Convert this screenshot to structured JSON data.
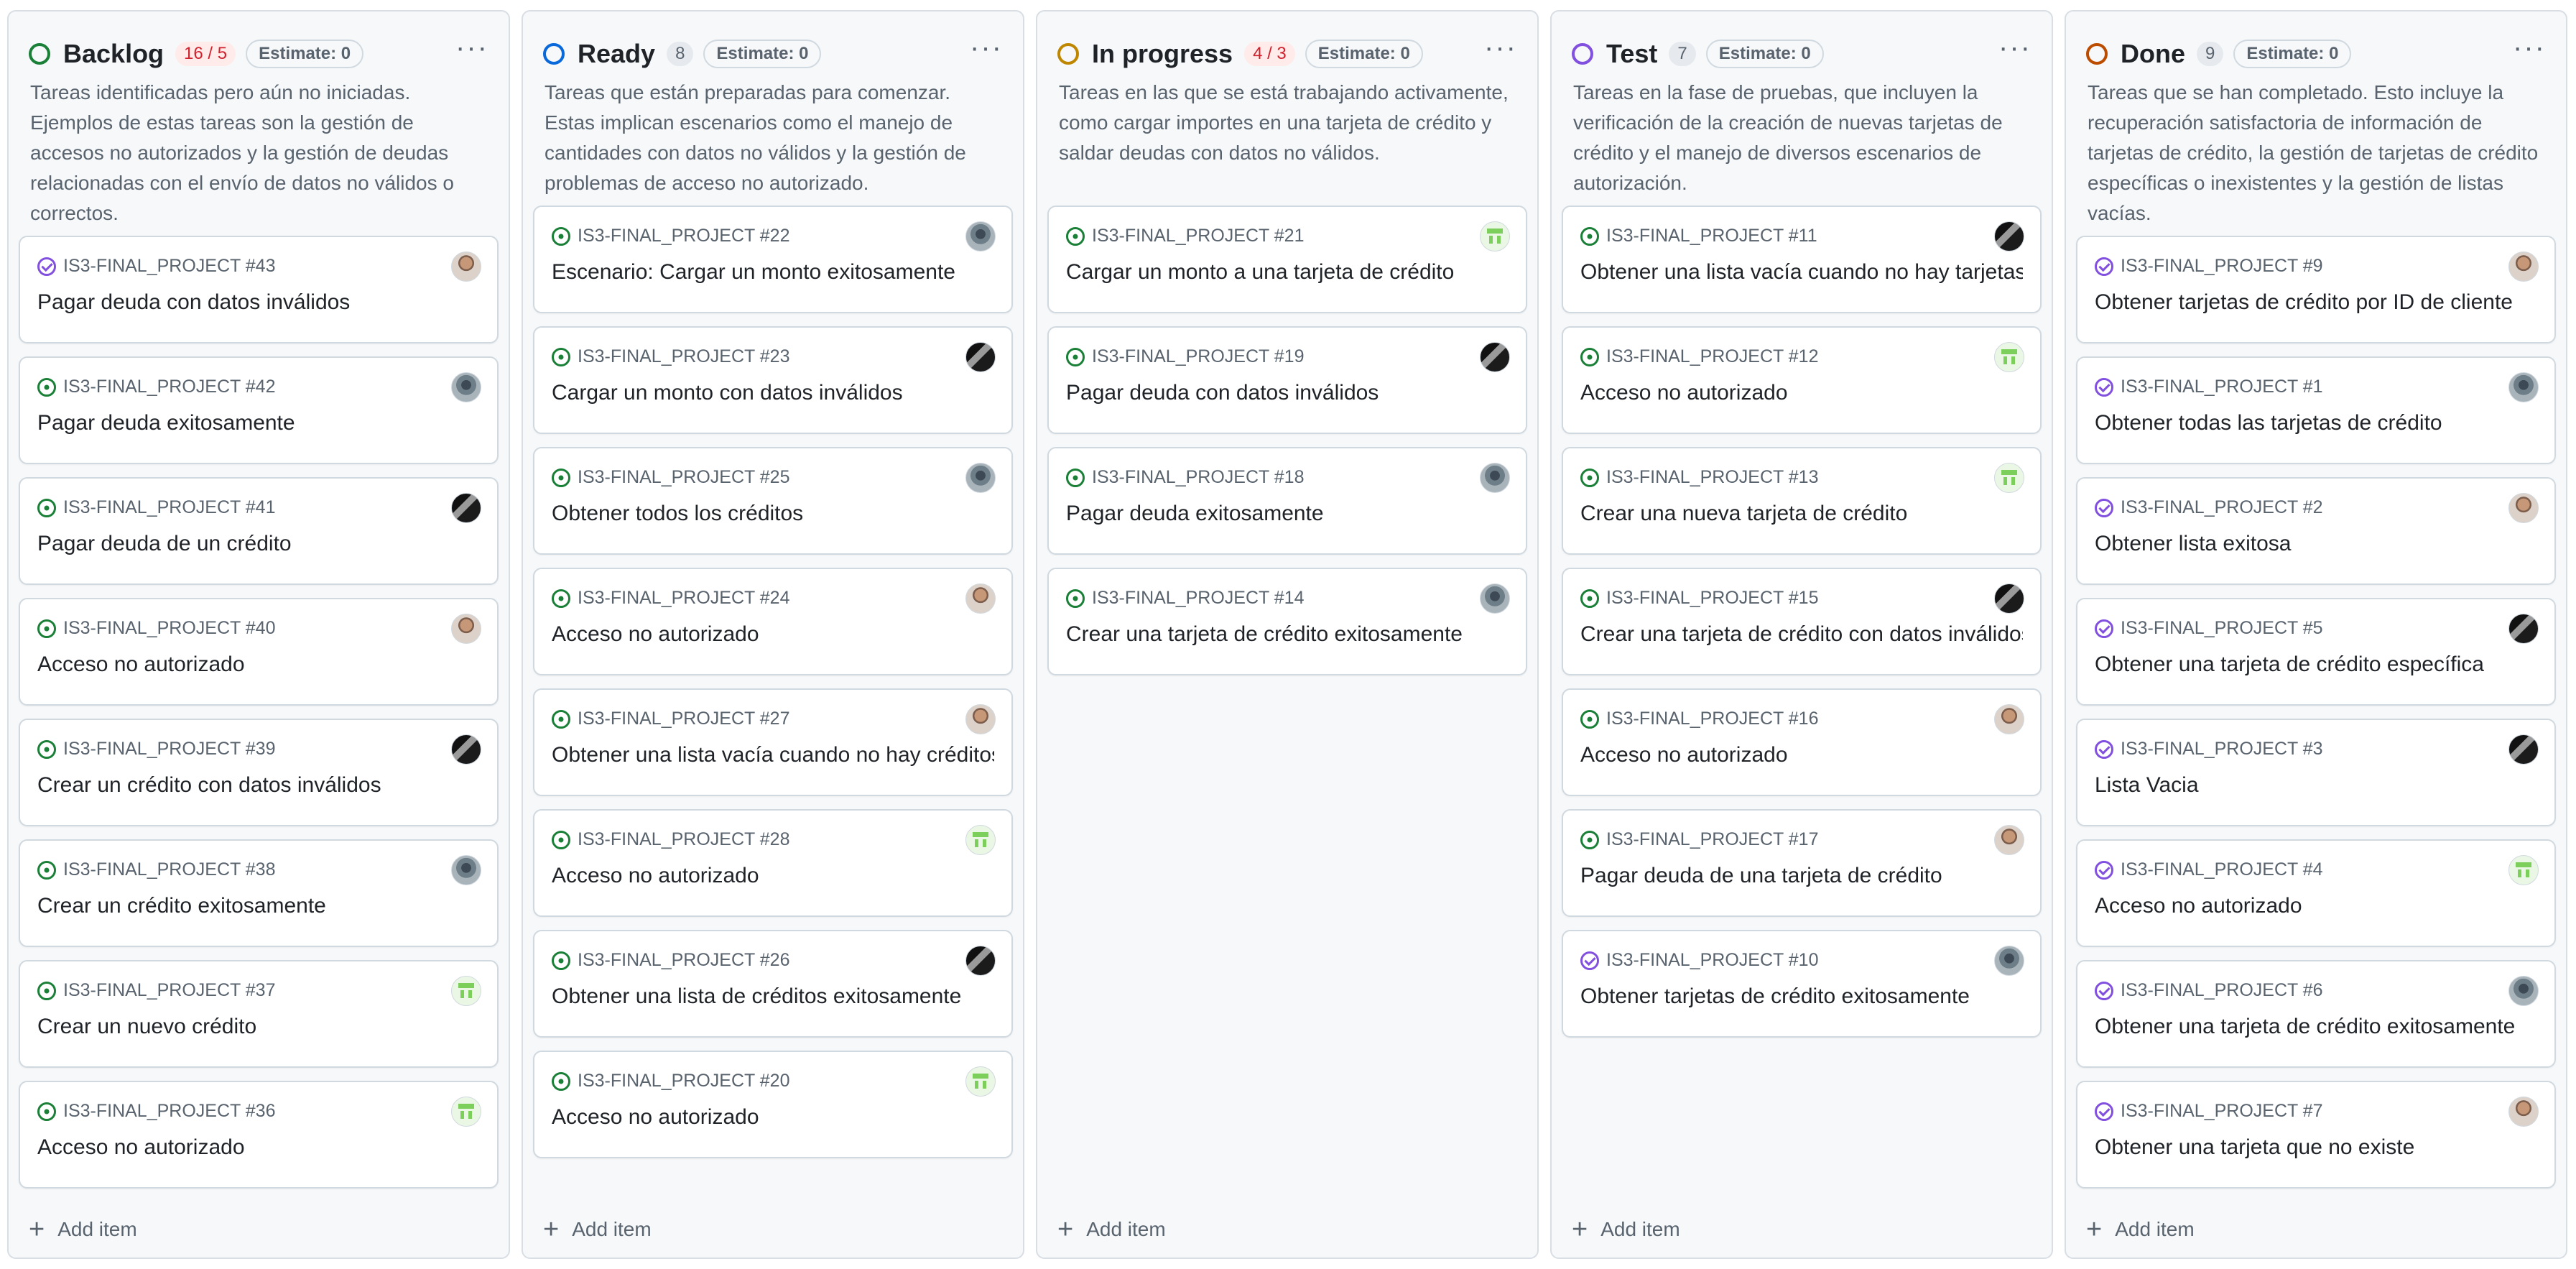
{
  "columns": [
    {
      "title": "Backlog",
      "count": "16 / 5",
      "count_over": true,
      "status_color": "#1a7f37",
      "estimate": "Estimate: 0",
      "description": "Tareas identificadas pero aún no iniciadas. Ejemplos de estas tareas son la gestión de accesos no autorizados y la gestión de deudas relacionadas con el envío de datos no válidos o correctos.",
      "add_item": "Add item",
      "cards": [
        {
          "ref": "IS3-FINAL_PROJECT #43",
          "title": "Pagar deuda con datos inválidos",
          "status": "closed",
          "avatar": "photo"
        },
        {
          "ref": "IS3-FINAL_PROJECT #42",
          "title": "Pagar deuda exitosamente",
          "status": "open",
          "avatar": "cap"
        },
        {
          "ref": "IS3-FINAL_PROJECT #41",
          "title": "Pagar deuda de un crédito",
          "status": "open",
          "avatar": "dark"
        },
        {
          "ref": "IS3-FINAL_PROJECT #40",
          "title": "Acceso no autorizado",
          "status": "open",
          "avatar": "photo"
        },
        {
          "ref": "IS3-FINAL_PROJECT #39",
          "title": "Crear un crédito con datos inválidos",
          "status": "open",
          "avatar": "dark"
        },
        {
          "ref": "IS3-FINAL_PROJECT #38",
          "title": "Crear un crédito exitosamente",
          "status": "open",
          "avatar": "cap"
        },
        {
          "ref": "IS3-FINAL_PROJECT #37",
          "title": "Crear un nuevo crédito",
          "status": "open",
          "avatar": "green"
        },
        {
          "ref": "IS3-FINAL_PROJECT #36",
          "title": "Acceso no autorizado",
          "status": "open",
          "avatar": "green"
        }
      ]
    },
    {
      "title": "Ready",
      "count": "8",
      "count_over": false,
      "status_color": "#0969da",
      "estimate": "Estimate: 0",
      "description": "Tareas que están preparadas para comenzar. Estas implican escenarios como el manejo de cantidades con datos no válidos y la gestión de problemas de acceso no autorizado.",
      "add_item": "Add item",
      "cards": [
        {
          "ref": "IS3-FINAL_PROJECT #22",
          "title": "Escenario: Cargar un monto exitosamente",
          "status": "open",
          "avatar": "cap"
        },
        {
          "ref": "IS3-FINAL_PROJECT #23",
          "title": "Cargar un monto con datos inválidos",
          "status": "open",
          "avatar": "dark"
        },
        {
          "ref": "IS3-FINAL_PROJECT #25",
          "title": "Obtener todos los créditos",
          "status": "open",
          "avatar": "cap"
        },
        {
          "ref": "IS3-FINAL_PROJECT #24",
          "title": "Acceso no autorizado",
          "status": "open",
          "avatar": "photo"
        },
        {
          "ref": "IS3-FINAL_PROJECT #27",
          "title": "Obtener una lista vacía cuando no hay créditos",
          "status": "open",
          "avatar": "photo"
        },
        {
          "ref": "IS3-FINAL_PROJECT #28",
          "title": "Acceso no autorizado",
          "status": "open",
          "avatar": "green"
        },
        {
          "ref": "IS3-FINAL_PROJECT #26",
          "title": "Obtener una lista de créditos exitosamente",
          "status": "open",
          "avatar": "dark"
        },
        {
          "ref": "IS3-FINAL_PROJECT #20",
          "title": "Acceso no autorizado",
          "status": "open",
          "avatar": "green"
        }
      ]
    },
    {
      "title": "In progress",
      "count": "4 / 3",
      "count_over": true,
      "status_color": "#bf8700",
      "estimate": "Estimate: 0",
      "description": "Tareas en las que se está trabajando activamente, como cargar importes en una tarjeta de crédito y saldar deudas con datos no válidos.",
      "add_item": "Add item",
      "cards": [
        {
          "ref": "IS3-FINAL_PROJECT #21",
          "title": "Cargar un monto a una tarjeta de crédito",
          "status": "open",
          "avatar": "green"
        },
        {
          "ref": "IS3-FINAL_PROJECT #19",
          "title": "Pagar deuda con datos inválidos",
          "status": "open",
          "avatar": "dark"
        },
        {
          "ref": "IS3-FINAL_PROJECT #18",
          "title": "Pagar deuda exitosamente",
          "status": "open",
          "avatar": "cap"
        },
        {
          "ref": "IS3-FINAL_PROJECT #14",
          "title": "Crear una tarjeta de crédito exitosamente",
          "status": "open",
          "avatar": "cap"
        }
      ]
    },
    {
      "title": "Test",
      "count": "7",
      "count_over": false,
      "status_color": "#8250df",
      "estimate": "Estimate: 0",
      "description": "Tareas en la fase de pruebas, que incluyen la verificación de la creación de nuevas tarjetas de crédito y el manejo de diversos escenarios de autorización.",
      "add_item": "Add item",
      "cards": [
        {
          "ref": "IS3-FINAL_PROJECT #11",
          "title": "Obtener una lista vacía cuando no hay tarjetas",
          "status": "open",
          "avatar": "dark"
        },
        {
          "ref": "IS3-FINAL_PROJECT #12",
          "title": "Acceso no autorizado",
          "status": "open",
          "avatar": "green"
        },
        {
          "ref": "IS3-FINAL_PROJECT #13",
          "title": "Crear una nueva tarjeta de crédito",
          "status": "open",
          "avatar": "green"
        },
        {
          "ref": "IS3-FINAL_PROJECT #15",
          "title": "Crear una tarjeta de crédito con datos inválidos",
          "status": "open",
          "avatar": "dark"
        },
        {
          "ref": "IS3-FINAL_PROJECT #16",
          "title": "Acceso no autorizado",
          "status": "open",
          "avatar": "photo"
        },
        {
          "ref": "IS3-FINAL_PROJECT #17",
          "title": "Pagar deuda de una tarjeta de crédito",
          "status": "open",
          "avatar": "photo"
        },
        {
          "ref": "IS3-FINAL_PROJECT #10",
          "title": "Obtener tarjetas de crédito exitosamente",
          "status": "closed",
          "avatar": "cap"
        }
      ]
    },
    {
      "title": "Done",
      "count": "9",
      "count_over": false,
      "status_color": "#bc4c00",
      "estimate": "Estimate: 0",
      "description": "Tareas que se han completado. Esto incluye la recuperación satisfactoria de información de tarjetas de crédito, la gestión de tarjetas de crédito específicas o inexistentes y la gestión de listas vacías.",
      "add_item": "Add item",
      "cards": [
        {
          "ref": "IS3-FINAL_PROJECT #9",
          "title": "Obtener tarjetas de crédito por ID de cliente",
          "status": "closed",
          "avatar": "photo"
        },
        {
          "ref": "IS3-FINAL_PROJECT #1",
          "title": "Obtener todas las tarjetas de crédito",
          "status": "closed",
          "avatar": "cap"
        },
        {
          "ref": "IS3-FINAL_PROJECT #2",
          "title": "Obtener lista exitosa",
          "status": "closed",
          "avatar": "photo"
        },
        {
          "ref": "IS3-FINAL_PROJECT #5",
          "title": "Obtener una tarjeta de crédito específica",
          "status": "closed",
          "avatar": "dark"
        },
        {
          "ref": "IS3-FINAL_PROJECT #3",
          "title": "Lista Vacia",
          "status": "closed",
          "avatar": "dark"
        },
        {
          "ref": "IS3-FINAL_PROJECT #4",
          "title": "Acceso no autorizado",
          "status": "closed",
          "avatar": "green"
        },
        {
          "ref": "IS3-FINAL_PROJECT #6",
          "title": "Obtener una tarjeta de crédito exitosamente",
          "status": "closed",
          "avatar": "cap"
        },
        {
          "ref": "IS3-FINAL_PROJECT #7",
          "title": "Obtener una tarjeta que no existe",
          "status": "closed",
          "avatar": "photo"
        }
      ]
    }
  ]
}
